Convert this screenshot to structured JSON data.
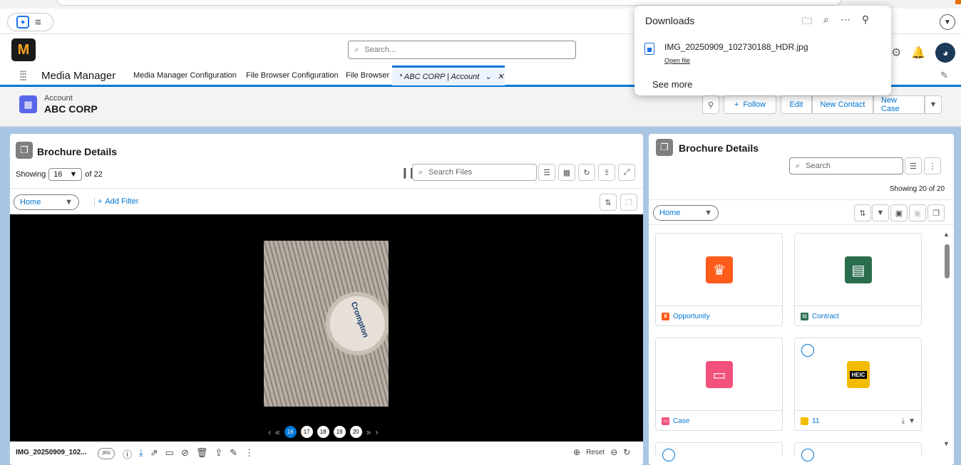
{
  "browser": {
    "copilot_label": "Copilot"
  },
  "header": {
    "logo_text": "M",
    "search_placeholder": "Search...",
    "app_name": "Media Manager"
  },
  "nav": {
    "tabs": [
      {
        "label": "Media Manager Configuration"
      },
      {
        "label": "File Browser Configuration"
      },
      {
        "label": "File Browser"
      }
    ],
    "active_tab": "* ABC CORP | Account"
  },
  "record": {
    "object_label": "Account",
    "name": "ABC CORP",
    "buttons": {
      "follow": "Follow",
      "edit": "Edit",
      "new_contact": "New Contact",
      "new_case": "New Case"
    }
  },
  "left_card": {
    "title": "Brochure Details",
    "showing_label": "Showing",
    "showing_value": "16",
    "of_label": "of 22",
    "search_placeholder": "Search Files",
    "folder": "Home",
    "add_filter": "Add Filter",
    "photo_brand": "Crompton",
    "pages": [
      "16",
      "17",
      "18",
      "19",
      "20"
    ],
    "active_page": "16",
    "file_name": "IMG_20250909_102...",
    "file_type": "JPG",
    "reset_label": "Reset"
  },
  "right_card": {
    "title": "Brochure Details",
    "search_placeholder": "Search",
    "showing": "Showing 20 of 20",
    "folder": "Home",
    "tiles": [
      {
        "label": "Opportunity",
        "color": "#fe5c1a",
        "icon": "crown-icon"
      },
      {
        "label": "Contract",
        "color": "#2b6e4f",
        "icon": "contract-icon"
      },
      {
        "label": "Case",
        "color": "#f2517d",
        "icon": "briefcase-icon"
      },
      {
        "label": "11",
        "color": "#f4bc00",
        "icon": "heic-file-icon",
        "badge": "HEIC"
      }
    ]
  },
  "downloads": {
    "title": "Downloads",
    "file_name": "IMG_20250909_102730188_HDR.jpg",
    "open_file": "Open file",
    "see_more": "See more"
  },
  "colors": {
    "brand": "#0176d3",
    "band": "#a9c7e4"
  }
}
